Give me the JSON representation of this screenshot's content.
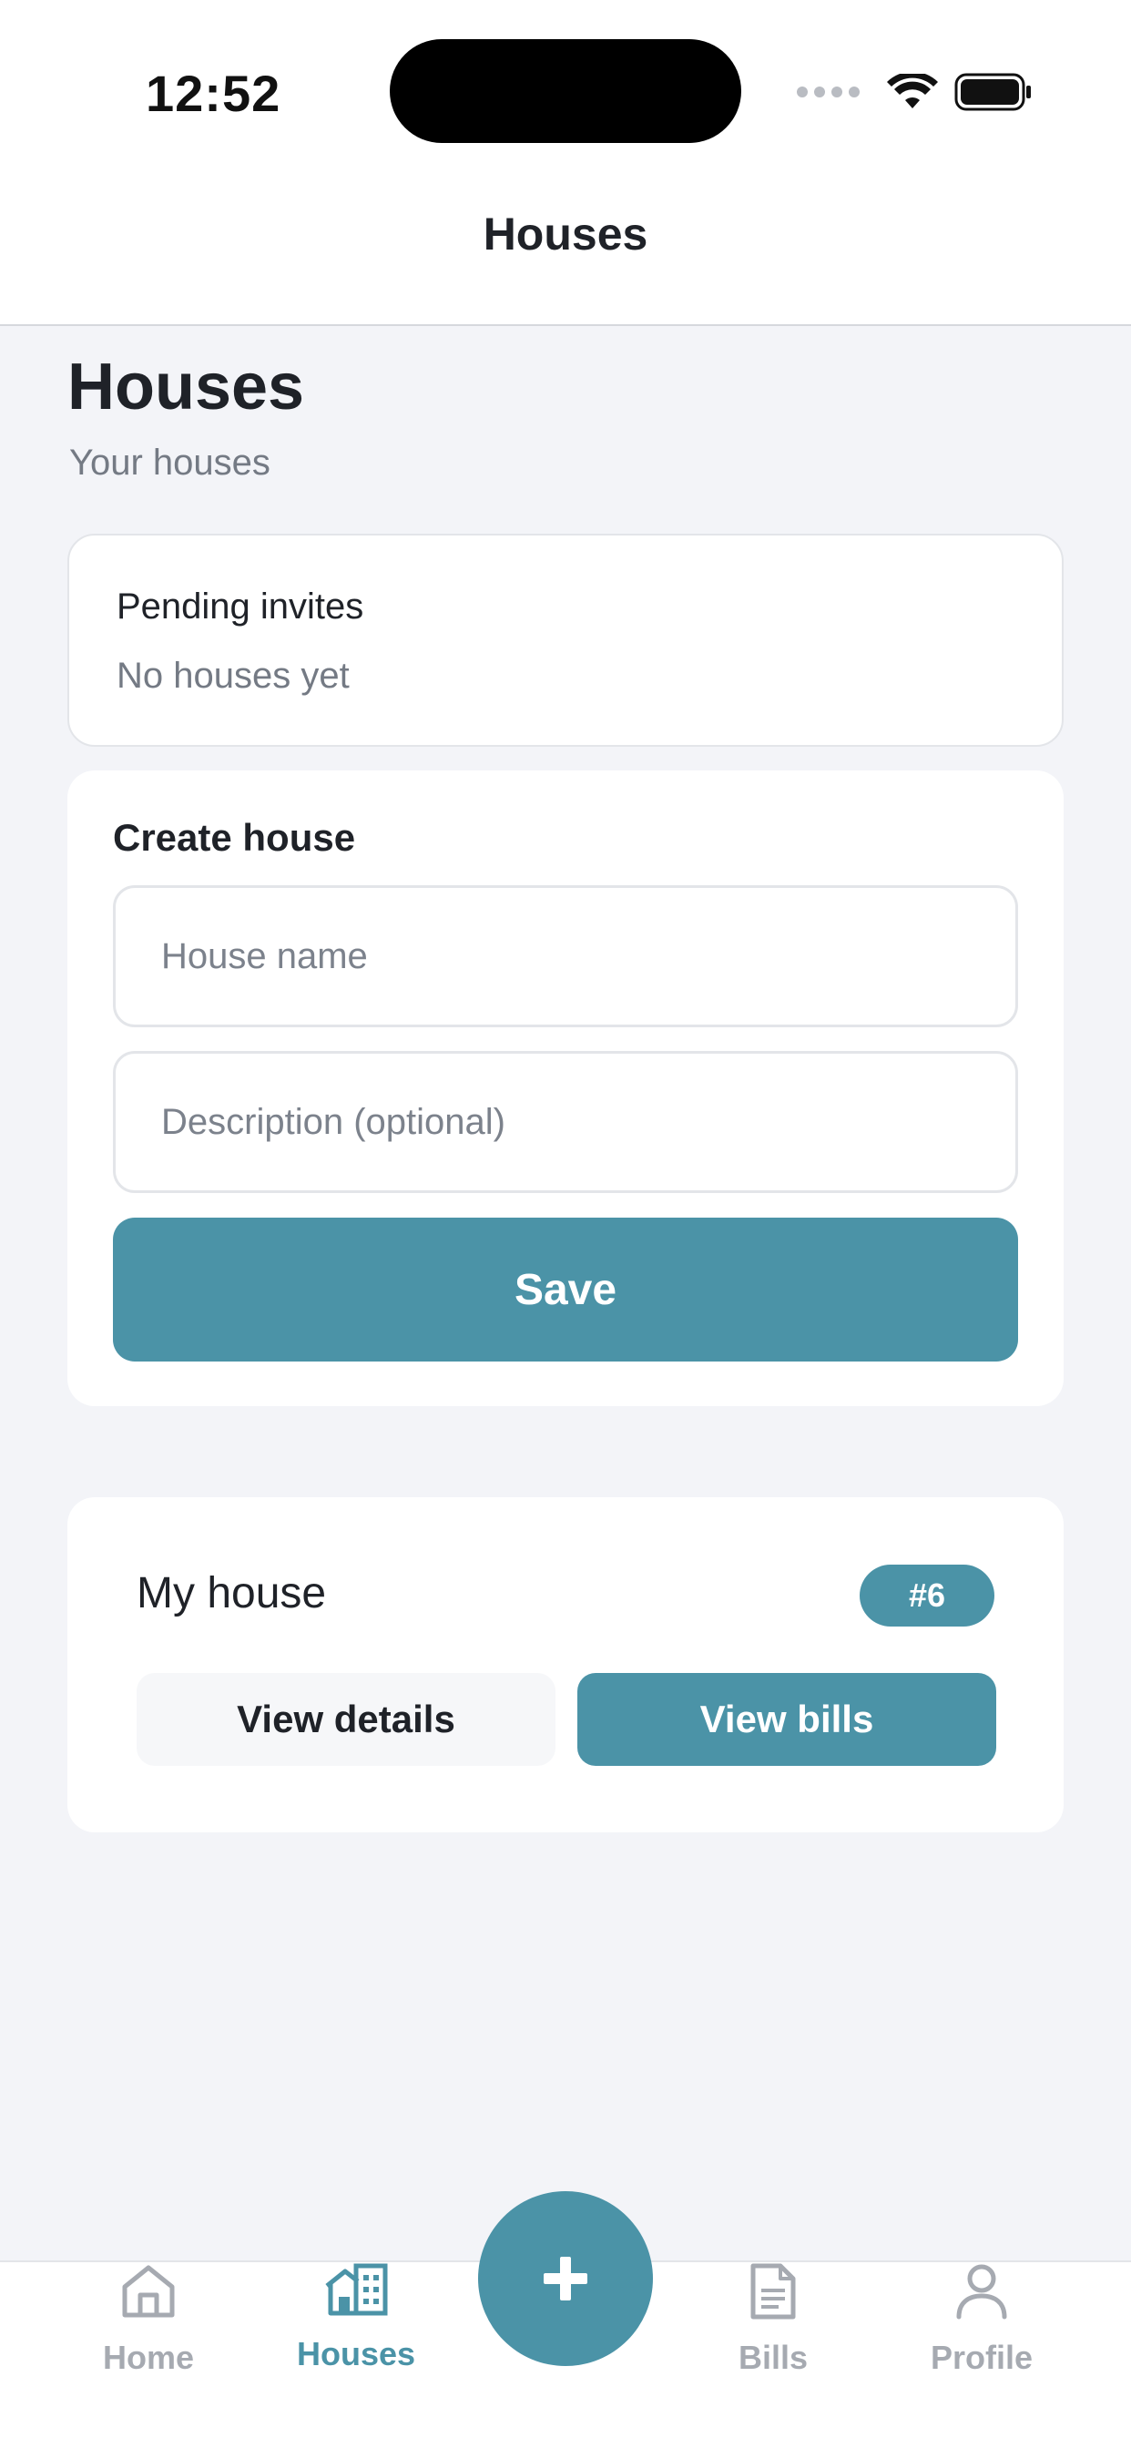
{
  "status_bar": {
    "time": "12:52"
  },
  "nav": {
    "title": "Houses"
  },
  "header": {
    "title": "Houses",
    "subtitle": "Your houses"
  },
  "pending_invites": {
    "title": "Pending invites",
    "empty_text": "No houses yet"
  },
  "create_house": {
    "title": "Create house",
    "name_placeholder": "House name",
    "name_value": "",
    "description_placeholder": "Description (optional)",
    "description_value": "",
    "save_label": "Save"
  },
  "houses": [
    {
      "name": "My house",
      "badge": "#6",
      "details_label": "View details",
      "bills_label": "View bills"
    }
  ],
  "tabbar": {
    "items": [
      {
        "label": "Home",
        "icon": "home-icon",
        "active": false
      },
      {
        "label": "Houses",
        "icon": "houses-icon",
        "active": true
      },
      {
        "label": "Bills",
        "icon": "document-icon",
        "active": false
      },
      {
        "label": "Profile",
        "icon": "person-icon",
        "active": false
      }
    ],
    "fab_icon": "plus-icon"
  },
  "colors": {
    "accent": "#4b93a7",
    "background": "#f3f4f8",
    "muted_text": "#747a84",
    "inactive_tab": "#a6aab1"
  }
}
